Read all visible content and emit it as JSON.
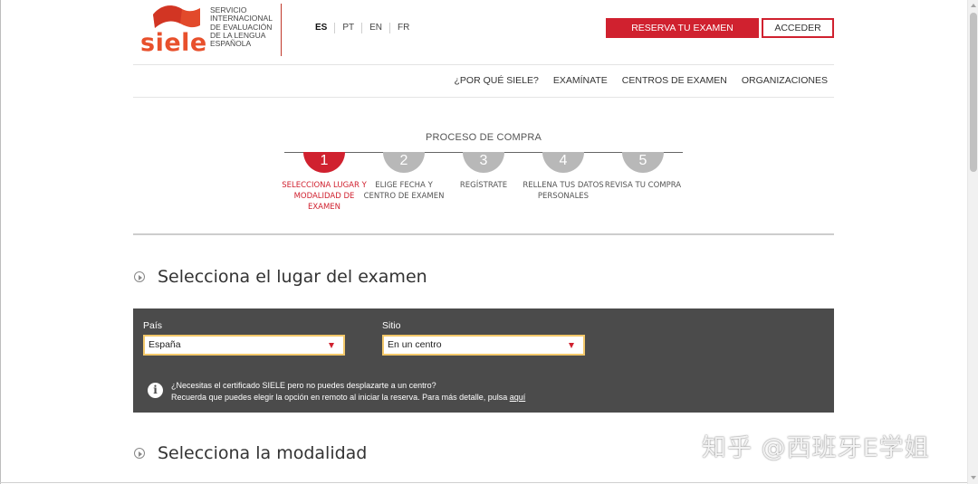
{
  "header": {
    "logo_word": "siele",
    "logo_desc_lines": [
      "SERVICIO",
      "INTERNACIONAL",
      "DE EVALUACIÓN",
      "DE LA LENGUA",
      "ESPAÑOLA"
    ],
    "languages": [
      "ES",
      "PT",
      "EN",
      "FR"
    ],
    "active_language": "ES",
    "reserve_button": "RESERVA TU EXAMEN",
    "access_button": "ACCEDER",
    "brand_color": "#d0212f",
    "logo_color": "#e8502c"
  },
  "nav": {
    "items": [
      "¿POR QUÉ SIELE?",
      "EXAMÍNATE",
      "CENTROS DE EXAMEN",
      "ORGANIZACIONES"
    ]
  },
  "process": {
    "title": "PROCESO DE COMPRA",
    "steps": [
      {
        "number": "1",
        "label": "SELECCIONA LUGAR Y MODALIDAD DE EXAMEN",
        "active": true
      },
      {
        "number": "2",
        "label": "ELIGE FECHA Y CENTRO DE EXAMEN",
        "active": false
      },
      {
        "number": "3",
        "label": "REGÍSTRATE",
        "active": false
      },
      {
        "number": "4",
        "label": "RELLENA TUS DATOS PERSONALES",
        "active": false
      },
      {
        "number": "5",
        "label": "REVISA TU COMPRA",
        "active": false
      }
    ]
  },
  "location_section": {
    "title": "Selecciona el lugar del examen",
    "country": {
      "label": "País",
      "value": "España"
    },
    "site": {
      "label": "Sitio",
      "value": "En un centro"
    },
    "info_line1": "¿Necesitas el certificado SIELE pero no puedes desplazarte a un centro?",
    "info_line2": "Recuerda que puedes elegir la opción en remoto al iniciar la reserva. Para más detalle, pulsa ",
    "info_link": "aquí"
  },
  "modality_section": {
    "title": "Selecciona la modalidad"
  },
  "watermark": "知乎 @西班牙E学姐"
}
